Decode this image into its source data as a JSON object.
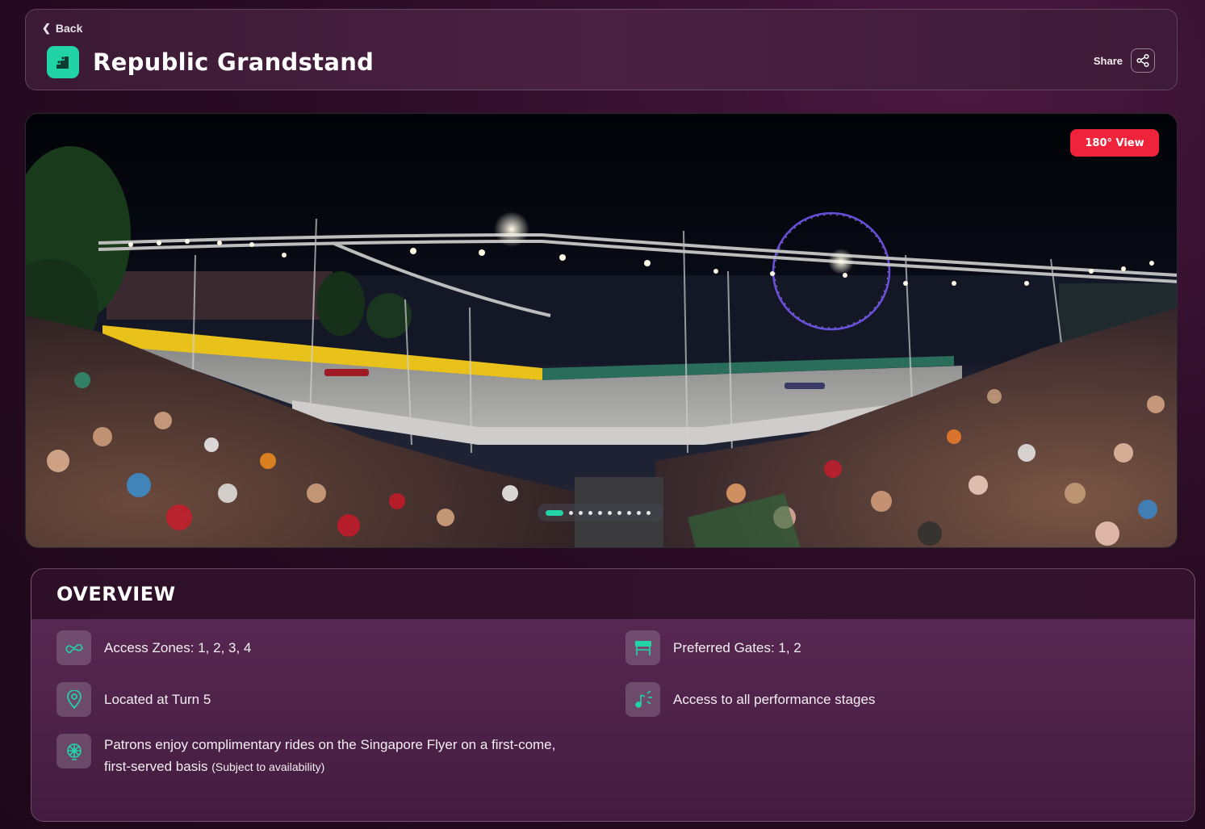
{
  "header": {
    "back_label": "Back",
    "title": "Republic Grandstand",
    "share_label": "Share"
  },
  "gallery": {
    "badge_label": "180° View",
    "slide_count": 10,
    "active_slide": 1
  },
  "overview": {
    "title": "OVERVIEW",
    "features": [
      {
        "icon": "track-map-icon",
        "text": "Access Zones: 1, 2, 3, 4"
      },
      {
        "icon": "gate-icon",
        "text": "Preferred Gates: 1, 2"
      },
      {
        "icon": "location-pin-icon",
        "text": "Located at Turn 5"
      },
      {
        "icon": "music-stage-icon",
        "text": "Access to all performance stages"
      },
      {
        "icon": "ferris-wheel-icon",
        "text_line1": "Patrons enjoy complimentary rides on the Singapore Flyer on a first-come,",
        "text_line2": "first-served basis",
        "note": "(Subject to availability)"
      }
    ]
  },
  "colors": {
    "accent": "#22d3a6",
    "badge": "#ef233c",
    "background": "#2a0c25"
  }
}
